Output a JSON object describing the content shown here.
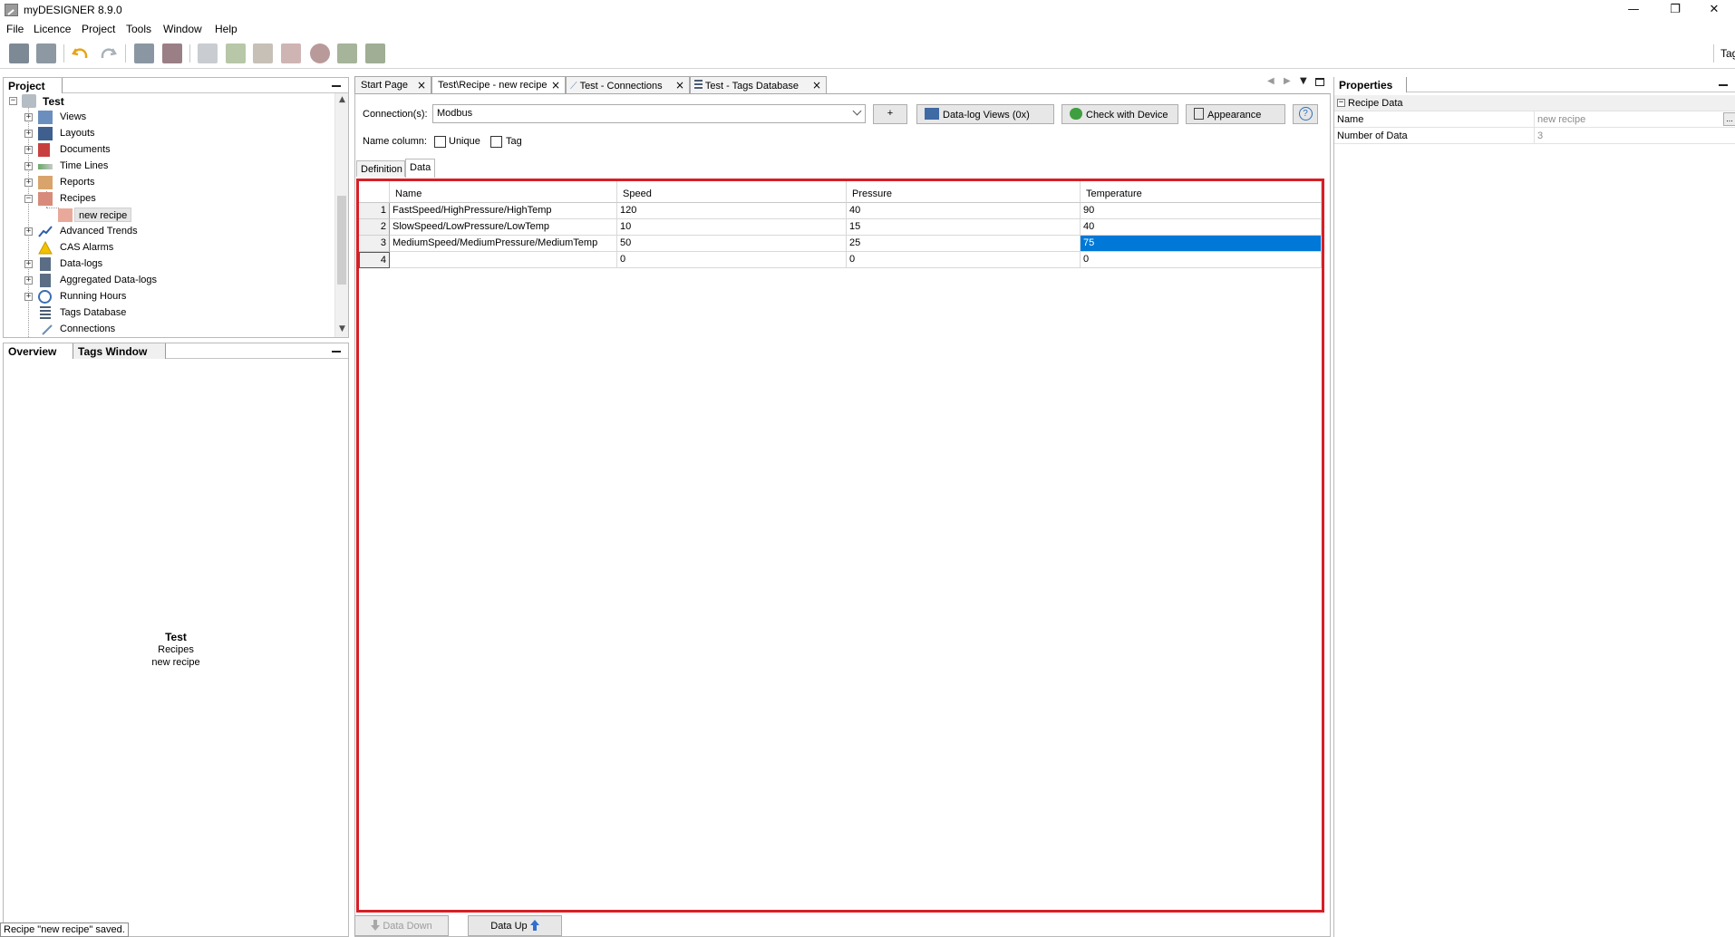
{
  "window": {
    "title": "myDESIGNER 8.9.0",
    "minimize_glyph": "—",
    "restore_glyph": "❐",
    "close_glyph": "✕"
  },
  "menu": [
    "File",
    "Licence",
    "Project",
    "Tools",
    "Window",
    "Help"
  ],
  "toolbar": {
    "icons": [
      "save-icon",
      "save-all-icon",
      "undo-icon",
      "redo-icon",
      "import-icon",
      "export-icon",
      "table-icon",
      "add-row-icon",
      "paste-row-icon",
      "delete-row-icon",
      "chart-icon",
      "upload-icon",
      "download-icon"
    ],
    "right_text": "Tag"
  },
  "project_panel": {
    "tab": "Project",
    "root": "Test",
    "items": [
      {
        "label": "Views",
        "icon": "views-icon",
        "expandable": true
      },
      {
        "label": "Layouts",
        "icon": "layouts-icon",
        "expandable": true
      },
      {
        "label": "Documents",
        "icon": "documents-icon",
        "expandable": true
      },
      {
        "label": "Time Lines",
        "icon": "timelines-icon",
        "expandable": true
      },
      {
        "label": "Reports",
        "icon": "reports-icon",
        "expandable": true
      },
      {
        "label": "Recipes",
        "icon": "recipes-icon",
        "expandable": true,
        "expanded": true
      },
      {
        "label": "new recipe",
        "icon": "recipe-icon",
        "child": true,
        "selected": true
      },
      {
        "label": "Advanced Trends",
        "icon": "trends-icon",
        "expandable": true
      },
      {
        "label": "CAS Alarms",
        "icon": "alarm-icon",
        "expandable": false
      },
      {
        "label": "Data-logs",
        "icon": "datalogs-icon",
        "expandable": true
      },
      {
        "label": "Aggregated Data-logs",
        "icon": "aggregated-icon",
        "expandable": true
      },
      {
        "label": "Running Hours",
        "icon": "clock-icon",
        "expandable": true
      },
      {
        "label": "Tags Database",
        "icon": "tags-db-icon",
        "expandable": false
      },
      {
        "label": "Connections",
        "icon": "connections-icon",
        "expandable": false
      }
    ]
  },
  "overview_panel": {
    "tabs": [
      "Overview",
      "Tags Window"
    ],
    "lines": [
      "Test",
      "Recipes",
      "new recipe"
    ]
  },
  "status_message": "Recipe \"new recipe\" saved.",
  "editor_tabs": [
    {
      "label": "Start Page",
      "active": false
    },
    {
      "label": "Test\\Recipe - new recipe",
      "active": true
    },
    {
      "label": "Test - Connections",
      "active": false
    },
    {
      "label": "Test - Tags Database",
      "active": false
    }
  ],
  "editor": {
    "connection_label": "Connection(s):",
    "connection_value": "Modbus",
    "add_label": "+",
    "datalog_label": "Data-log Views (0x)",
    "check_label": "Check with Device",
    "appearance_label": "Appearance",
    "help_label": "?",
    "name_column_label": "Name column:",
    "unique_label": "Unique",
    "tag_label": "Tag",
    "subtabs": [
      "Definition",
      "Data"
    ],
    "columns": [
      "Name",
      "Speed",
      "Pressure",
      "Temperature"
    ],
    "rows": [
      {
        "n": "1",
        "cells": [
          "FastSpeed/HighPressure/HighTemp",
          "120",
          "40",
          "90"
        ]
      },
      {
        "n": "2",
        "cells": [
          "SlowSpeed/LowPressure/LowTemp",
          "10",
          "15",
          "40"
        ]
      },
      {
        "n": "3",
        "cells": [
          "MediumSpeed/MediumPressure/MediumTemp",
          "50",
          "25",
          "75"
        ]
      },
      {
        "n": "4",
        "cells": [
          "",
          "0",
          "0",
          "0"
        ]
      }
    ],
    "data_down_label": "Data Down",
    "data_up_label": "Data Up"
  },
  "properties": {
    "tab": "Properties",
    "section": "Recipe Data",
    "rows": [
      {
        "name": "Name",
        "value": "new recipe"
      },
      {
        "name": "Number of Data",
        "value": "3"
      }
    ]
  },
  "colors": {
    "accent_selection": "#0078d7",
    "highlight_border": "#d61f26"
  }
}
